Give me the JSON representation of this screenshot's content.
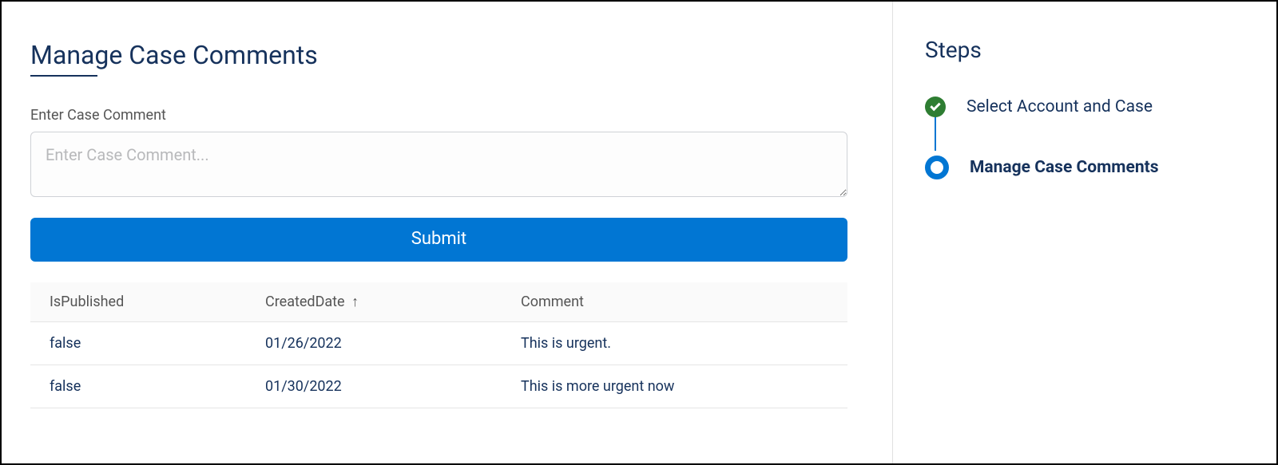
{
  "main": {
    "title": "Manage Case Comments",
    "field_label": "Enter Case Comment",
    "input_placeholder": "Enter Case Comment...",
    "submit_label": "Submit"
  },
  "table": {
    "headers": {
      "is_published": "IsPublished",
      "created_date": "CreatedDate",
      "comment": "Comment"
    },
    "sort_icon_name": "arrow-up-icon",
    "rows": [
      {
        "is_published": "false",
        "created_date": "01/26/2022",
        "comment": "This is urgent."
      },
      {
        "is_published": "false",
        "created_date": "01/30/2022",
        "comment": "This is more urgent now"
      }
    ]
  },
  "sidebar": {
    "title": "Steps",
    "steps": [
      {
        "label": "Select Account and Case",
        "state": "complete"
      },
      {
        "label": "Manage Case Comments",
        "state": "current"
      }
    ]
  }
}
